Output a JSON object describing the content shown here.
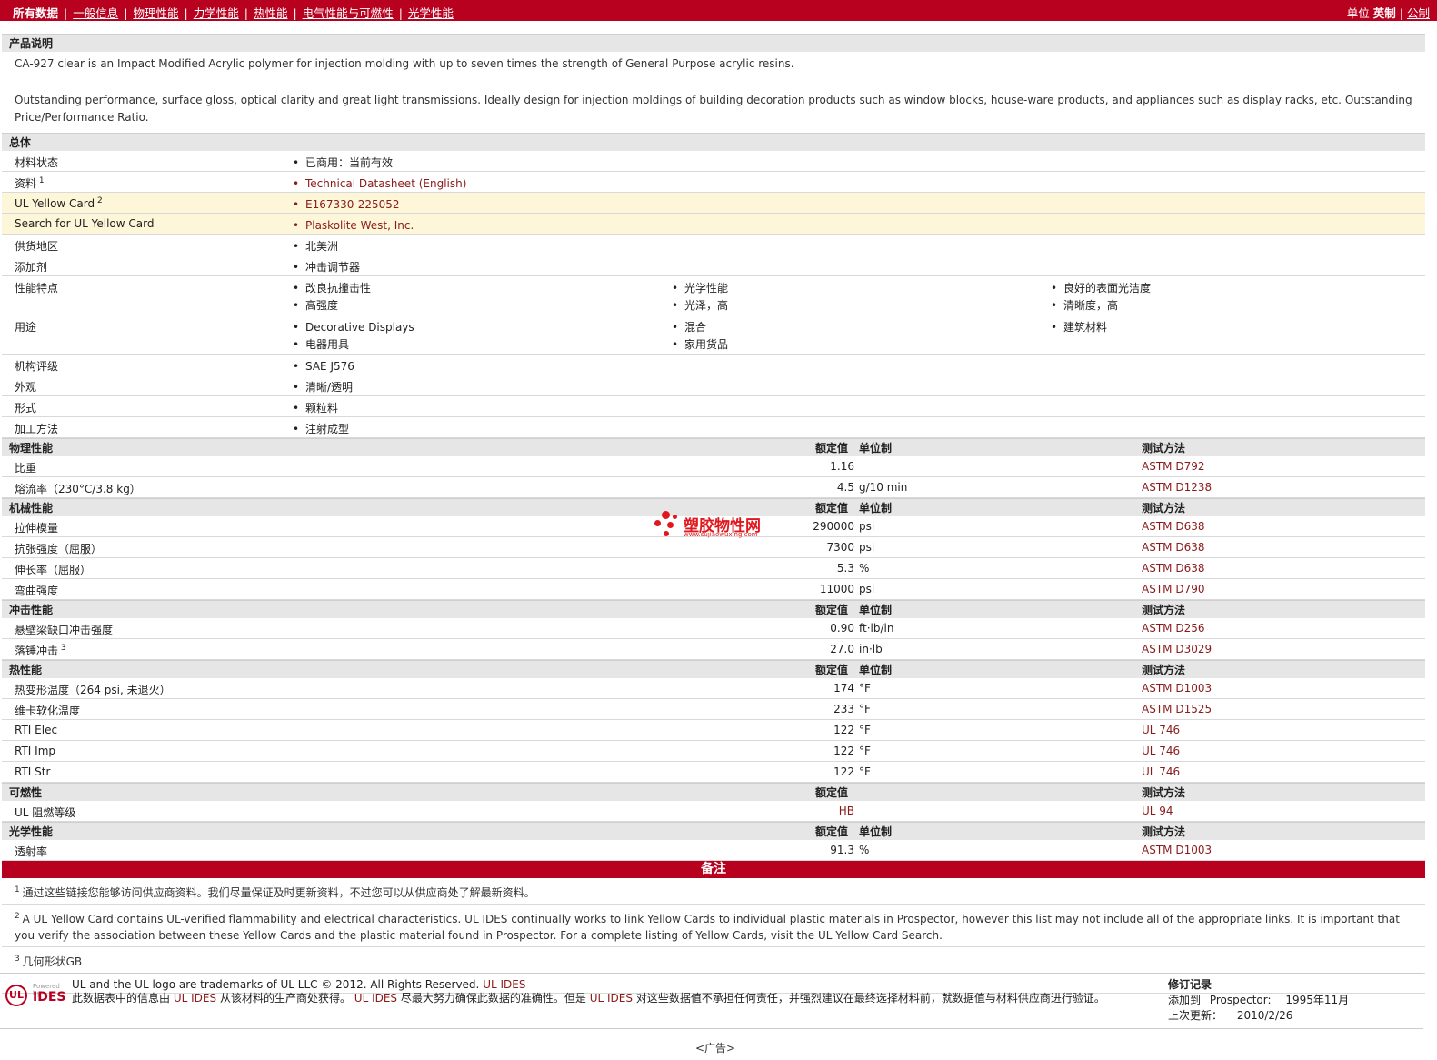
{
  "nav": {
    "tabs": [
      "所有数据",
      "一般信息",
      "物理性能",
      "力学性能",
      "热性能",
      "电气性能与可燃性",
      "光学性能"
    ],
    "units_label": "单位",
    "units_active": "英制",
    "units_other": "公制"
  },
  "description": {
    "title": "产品说明",
    "p1": "CA-927 clear is an Impact Modified Acrylic polymer for injection molding with up to seven times the strength of General Purpose acrylic resins.",
    "p2": "Outstanding performance, surface gloss, optical clarity and great light transmissions. Ideally design for injection moldings of building decoration products such as window blocks, house-ware products, and appliances such as display racks, etc. Outstanding Price/Performance Ratio."
  },
  "general": {
    "title": "总体",
    "rows": [
      {
        "label": "材料状态",
        "sup": "",
        "values": [
          "已商用：当前有效"
        ]
      },
      {
        "label": "资料",
        "sup": "1",
        "values": [
          "Technical Datasheet (English)"
        ]
      },
      {
        "label": "UL Yellow Card",
        "sup": "2",
        "values": [
          "E167330-225052"
        ]
      },
      {
        "label": "Search for UL Yellow Card",
        "sup": "",
        "values": [
          "Plaskolite West, Inc."
        ]
      },
      {
        "label": "供货地区",
        "sup": "",
        "values": [
          "北美洲"
        ]
      },
      {
        "label": "添加剂",
        "sup": "",
        "values": [
          "冲击调节器"
        ]
      },
      {
        "label": "性能特点",
        "sup": "",
        "col1": [
          "改良抗撞击性",
          "高强度"
        ],
        "col2": [
          "光学性能",
          "光泽，高"
        ],
        "col3": [
          "良好的表面光洁度",
          "清晰度，高"
        ]
      },
      {
        "label": "用途",
        "sup": "",
        "col1": [
          "Decorative Displays",
          "电器用具"
        ],
        "col2": [
          "混合",
          "家用货品"
        ],
        "col3": [
          "建筑材料"
        ]
      },
      {
        "label": "机构评级",
        "sup": "",
        "values": [
          "SAE J576"
        ]
      },
      {
        "label": "外观",
        "sup": "",
        "values": [
          "清晰/透明"
        ]
      },
      {
        "label": "形式",
        "sup": "",
        "values": [
          "颗粒料"
        ]
      },
      {
        "label": "加工方法",
        "sup": "",
        "values": [
          "注射成型"
        ]
      }
    ]
  },
  "headers": {
    "value": "额定值",
    "unit": "单位制",
    "method": "测试方法"
  },
  "sections": [
    {
      "title": "物理性能",
      "show_unit": true,
      "rows": [
        {
          "label": "比重",
          "cond": "",
          "sup": "",
          "value": "1.16",
          "unit": "",
          "method": "ASTM D792"
        },
        {
          "label": "熔流率",
          "cond": "（230°C/3.8 kg）",
          "sup": "",
          "value": "4.5",
          "unit": "g/10 min",
          "method": "ASTM D1238"
        }
      ]
    },
    {
      "title": "机械性能",
      "show_unit": true,
      "rows": [
        {
          "label": "拉伸模量",
          "cond": "",
          "sup": "",
          "value": "290000",
          "unit": "psi",
          "method": "ASTM D638"
        },
        {
          "label": "抗张强度",
          "cond": "（屈服）",
          "sup": "",
          "value": "7300",
          "unit": "psi",
          "method": "ASTM D638"
        },
        {
          "label": "伸长率",
          "cond": "（屈服）",
          "sup": "",
          "value": "5.3",
          "unit": "%",
          "method": "ASTM D638"
        },
        {
          "label": "弯曲强度",
          "cond": "",
          "sup": "",
          "value": "11000",
          "unit": "psi",
          "method": "ASTM D790"
        }
      ]
    },
    {
      "title": "冲击性能",
      "show_unit": true,
      "rows": [
        {
          "label": "悬壁梁缺口冲击强度",
          "cond": "",
          "sup": "",
          "value": "0.90",
          "unit": "ft·lb/in",
          "method": "ASTM D256"
        },
        {
          "label": "落锤冲击",
          "cond": "",
          "sup": "3",
          "value": "27.0",
          "unit": "in·lb",
          "method": "ASTM D3029"
        }
      ]
    },
    {
      "title": "热性能",
      "show_unit": true,
      "rows": [
        {
          "label": "热变形温度",
          "cond": "（264 psi, 未退火）",
          "sup": "",
          "value": "174",
          "unit": "°F",
          "method": "ASTM D1003"
        },
        {
          "label": "维卡软化温度",
          "cond": "",
          "sup": "",
          "value": "233",
          "unit": "°F",
          "method": "ASTM D1525"
        },
        {
          "label": "RTI Elec",
          "cond": "",
          "sup": "",
          "value": "122",
          "unit": "°F",
          "method": "UL 746"
        },
        {
          "label": "RTI Imp",
          "cond": "",
          "sup": "",
          "value": "122",
          "unit": "°F",
          "method": "UL 746"
        },
        {
          "label": "RTI Str",
          "cond": "",
          "sup": "",
          "value": "122",
          "unit": "°F",
          "method": "UL 746"
        }
      ]
    },
    {
      "title": "可燃性",
      "show_unit": false,
      "rows": [
        {
          "label": "UL 阻燃等级",
          "cond": "",
          "sup": "",
          "value": "HB",
          "unit": "",
          "method": "UL 94"
        }
      ]
    },
    {
      "title": "光学性能",
      "show_unit": true,
      "rows": [
        {
          "label": "透射率",
          "cond": "",
          "sup": "",
          "value": "91.3",
          "unit": "%",
          "method": "ASTM D1003"
        }
      ]
    }
  ],
  "notes": {
    "title": "备注",
    "items": [
      {
        "num": "1",
        "text": "通过这些链接您能够访问供应商资料。我们尽量保证及时更新资料，不过您可以从供应商处了解最新资料。"
      },
      {
        "num": "2",
        "text": "A UL Yellow Card contains UL-verified flammability and electrical characteristics. UL IDES continually works to link Yellow Cards to individual plastic materials in Prospector, however this list may not include all of the appropriate links. It is important that you verify the association between these Yellow Cards and the plastic material found in Prospector. For a complete listing of Yellow Cards, visit the UL Yellow Card Search."
      },
      {
        "num": "3",
        "text": "几何形状GB"
      }
    ]
  },
  "footer": {
    "logo_powered": "Powered by",
    "logo_ul": "UL",
    "logo_ides": "IDES",
    "trademark": "UL and the UL logo are trademarks of UL LLC © 2012. All Rights Reserved.",
    "trademark_link": "UL IDES",
    "disclaimer_1": "此数据表中的信息由",
    "disclaimer_ul1": "UL IDES",
    "disclaimer_2": "从该材料的生产商处获得。",
    "disclaimer_ul2": "UL IDES",
    "disclaimer_3": "尽最大努力确保此数据的准确性。但是",
    "disclaimer_ul3": "UL IDES",
    "disclaimer_4": "对这些数据值不承担任何责任，并强烈建议在最终选择材料前，就数据值与材料供应商进行验证。",
    "revision_title": "修订记录",
    "added_label": "添加到",
    "added_where": "Prospector:",
    "added_date": "1995年11月",
    "updated_label": "上次更新：",
    "updated_date": "2010/2/26",
    "ad": "<广告>"
  },
  "watermark": {
    "title": "塑胶物性网",
    "url": "www.sujiaowuxing.com"
  },
  "colors": {
    "brand_red": "#b8001f",
    "link": "#8b1a1a",
    "highlight": "#fdf6d8"
  }
}
